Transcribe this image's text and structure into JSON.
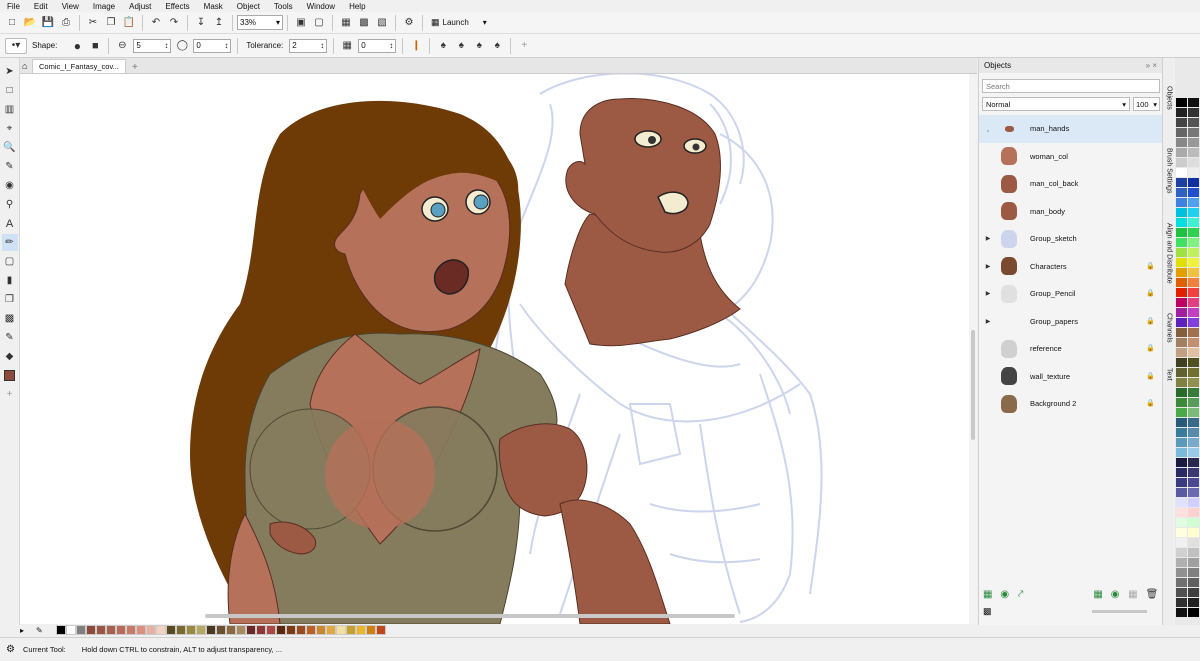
{
  "menu": [
    "File",
    "Edit",
    "View",
    "Image",
    "Adjust",
    "Effects",
    "Mask",
    "Object",
    "Tools",
    "Window",
    "Help"
  ],
  "toolbar": {
    "zoom": "33%",
    "launch_label": "Launch"
  },
  "property_bar": {
    "shape_label": "Shape:",
    "size_value": "5",
    "rotation_value": "0",
    "tolerance_label": "Tolerance:",
    "tolerance_value": "2",
    "transparency_value": "0"
  },
  "document": {
    "tab_title": "Comic_I_Fantasy_cov..."
  },
  "objects_panel": {
    "title": "Objects",
    "search_placeholder": "Search",
    "blend_mode": "Normal",
    "opacity": "100",
    "items": [
      {
        "name": "man_hands",
        "selected": true,
        "expandable": false,
        "locked": false
      },
      {
        "name": "woman_col",
        "selected": false,
        "expandable": false,
        "locked": false
      },
      {
        "name": "man_col_back",
        "selected": false,
        "expandable": false,
        "locked": false
      },
      {
        "name": "man_body",
        "selected": false,
        "expandable": false,
        "locked": false
      },
      {
        "name": "Group_sketch",
        "selected": false,
        "expandable": true,
        "locked": false
      },
      {
        "name": "Characters",
        "selected": false,
        "expandable": true,
        "locked": true
      },
      {
        "name": "Group_Pencil",
        "selected": false,
        "expandable": true,
        "locked": true
      },
      {
        "name": "Group_papers",
        "selected": false,
        "expandable": true,
        "locked": true
      },
      {
        "name": "reference",
        "selected": false,
        "expandable": false,
        "locked": true
      },
      {
        "name": "wall_texture",
        "selected": false,
        "expandable": false,
        "locked": true
      },
      {
        "name": "Background 2",
        "selected": false,
        "expandable": false,
        "locked": true
      }
    ]
  },
  "side_tabs": [
    "Objects",
    "Brush Settings",
    "Align and Distribute",
    "Channels",
    "Text"
  ],
  "status": {
    "tool_label": "Current Tool:",
    "hint": "Hold down CTRL to constrain, ALT to adjust transparency, ..."
  },
  "colors": {
    "hair": "#6e3a06",
    "skin_woman": "#b5715a",
    "skin_man": "#9c5a45",
    "shirt": "#857c5e",
    "sketch": "#cdd5ee",
    "selection": "#dbe8f6"
  },
  "palette_bottom": [
    "#000000",
    "#ffffff",
    "#808080",
    "#8b4a3c",
    "#9a5545",
    "#a86050",
    "#b86b5a",
    "#c87a6a",
    "#d99080",
    "#e8b0a0",
    "#f4d0c0",
    "#5a4a20",
    "#7a6a30",
    "#9a8a40",
    "#b5a860",
    "#4a3820",
    "#6a5030",
    "#8a6840",
    "#a88a60",
    "#6a2828",
    "#8a3838",
    "#aa4848",
    "#5a2a10",
    "#7a3a18",
    "#9a4a20",
    "#ba6028",
    "#c88830",
    "#e0a840",
    "#f4e0a0",
    "#c8a030",
    "#e8b828",
    "#d08010",
    "#c04818"
  ],
  "palette_side_a": [
    "#000000",
    "#222222",
    "#444444",
    "#666666",
    "#888888",
    "#aaaaaa",
    "#cccccc",
    "#ffffff",
    "#2040a0",
    "#3060c0",
    "#4080e0",
    "#00c0e0",
    "#00e0e0",
    "#20c040",
    "#40e060",
    "#a0e040",
    "#e0e000",
    "#e0a000",
    "#e06000",
    "#e02000",
    "#c00060",
    "#a020a0",
    "#6020c0",
    "#806040",
    "#a08060",
    "#c0a080",
    "#404020",
    "#606030",
    "#808040",
    "#2a6a2a",
    "#3a8a3a",
    "#4aaa4a",
    "#2a5a7a",
    "#3a7a9a",
    "#5a9aba",
    "#7abada",
    "#1a1a40",
    "#2a2a60",
    "#3a3a80",
    "#5a5aa0",
    "#e0e0ff",
    "#ffe0e0",
    "#e0ffe0",
    "#ffffe0",
    "#f0f0f0",
    "#d0d0d0",
    "#b0b0b0",
    "#909090",
    "#707070",
    "#505050",
    "#303030",
    "#101010"
  ],
  "palette_side_b": [
    "#111111",
    "#333333",
    "#555555",
    "#777777",
    "#999999",
    "#bbbbbb",
    "#dddddd",
    "#eeeeee",
    "#1030a0",
    "#2050d0",
    "#50a0f0",
    "#20d0f0",
    "#40f0d0",
    "#30d050",
    "#80f080",
    "#c0f060",
    "#f0f040",
    "#f0c040",
    "#f08040",
    "#f04040",
    "#e04080",
    "#c040c0",
    "#8040e0",
    "#a07050",
    "#c09070",
    "#e0c0a0",
    "#505020",
    "#707030",
    "#909050",
    "#3a7a3a",
    "#5a9a5a",
    "#7aba7a",
    "#3a6a8a",
    "#5a8aaa",
    "#7aaaca",
    "#9acaea",
    "#2a2a50",
    "#3a3a70",
    "#4a4a90",
    "#6a6ab0",
    "#d0d0ff",
    "#ffd0d0",
    "#d0ffd0",
    "#ffffd0",
    "#e0e0e0",
    "#c0c0c0",
    "#a0a0a0",
    "#808080",
    "#606060",
    "#404040",
    "#202020",
    "#000000"
  ]
}
